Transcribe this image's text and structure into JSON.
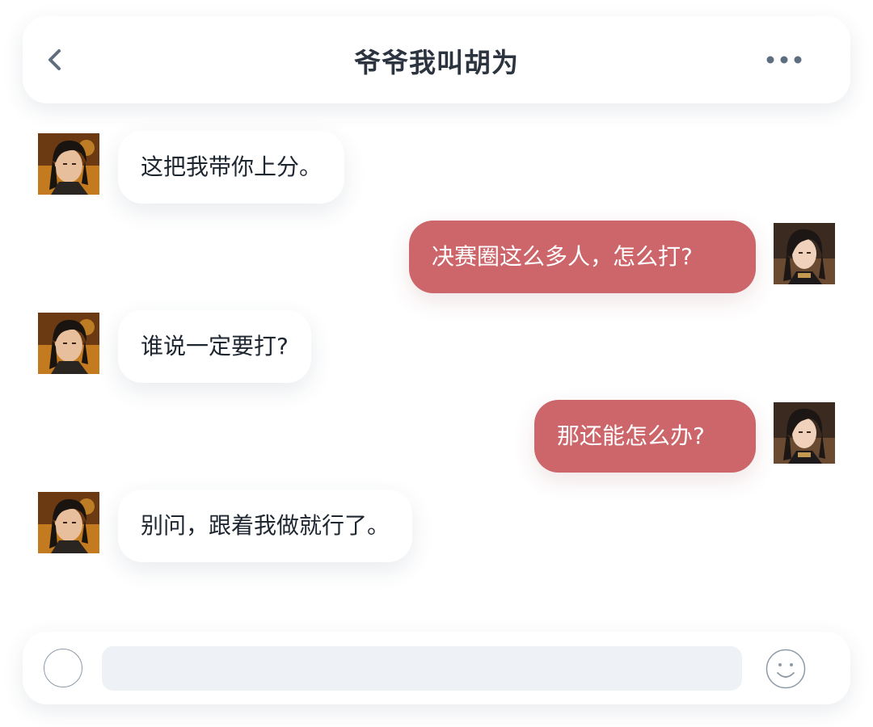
{
  "header": {
    "title": "爷爷我叫胡为",
    "back_icon": "chevron-left-icon",
    "more_icon": "more-horizontal-icon"
  },
  "messages": [
    {
      "from": "contact",
      "text": "这把我带你上分。"
    },
    {
      "from": "self",
      "text": "决赛圈这么多人，怎么打?"
    },
    {
      "from": "contact",
      "text": "谁说一定要打?"
    },
    {
      "from": "self",
      "text": "那还能怎么办?"
    },
    {
      "from": "contact",
      "text": "别问，跟着我做就行了。"
    }
  ],
  "input_bar": {
    "left_icon": "circle-icon",
    "input_value": "",
    "input_placeholder": "",
    "right_icon": "smiley-icon"
  },
  "colors": {
    "outgoing_bubble": "#cc666a",
    "incoming_bubble": "#ffffff",
    "title_text": "#2c3440",
    "input_background": "#eef1f5"
  }
}
